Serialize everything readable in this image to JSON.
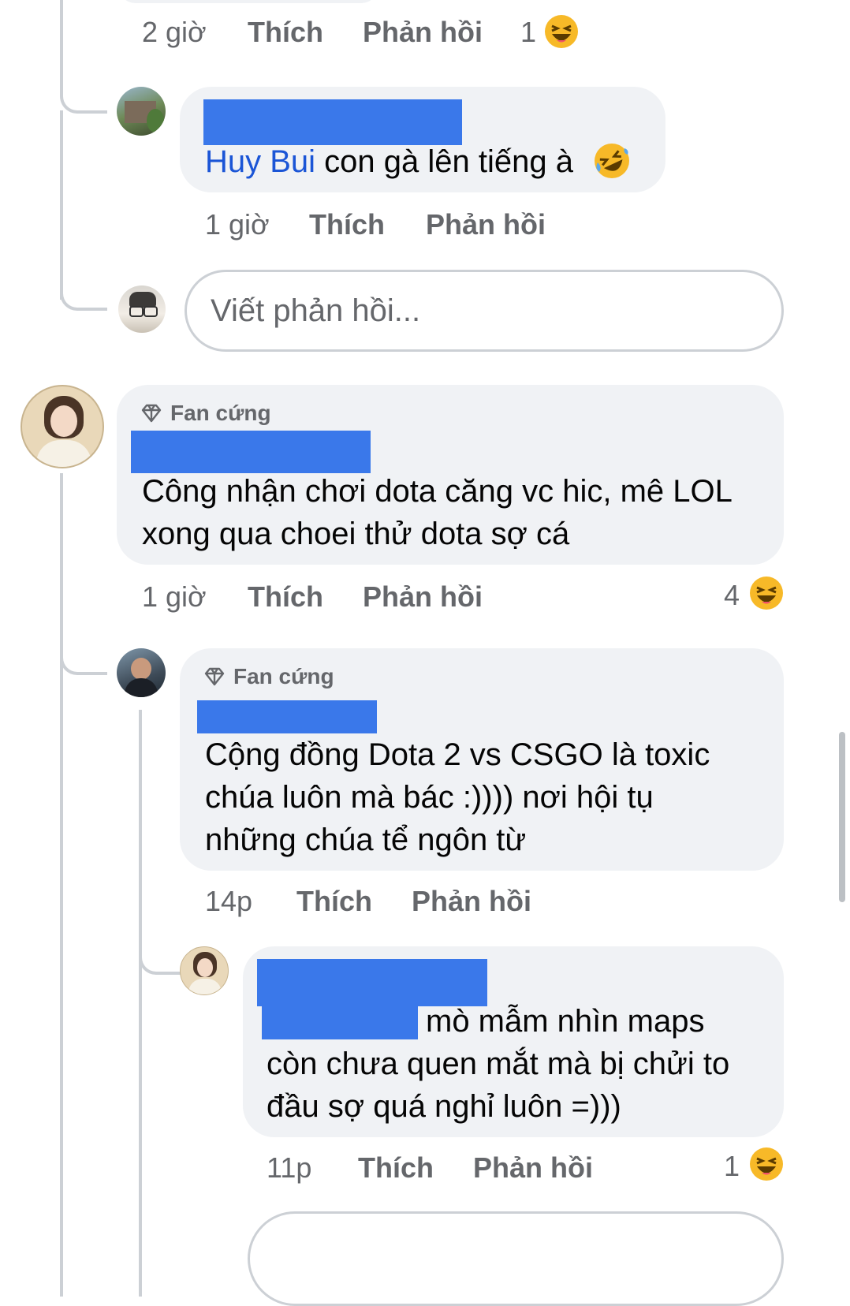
{
  "comments": [
    {
      "id": "c0_tail",
      "time": "2 giờ",
      "like": "Thích",
      "reply": "Phản hồi",
      "reaction_count": "1",
      "reaction_icon": "laughing-emoji-icon"
    },
    {
      "id": "c1",
      "mention": "Huy Bui",
      "text": " con gà lên tiếng à",
      "emoji_icon": "rolling-laughing-emoji-icon",
      "time": "1 giờ",
      "like": "Thích",
      "reply": "Phản hồi"
    },
    {
      "id": "c2",
      "badge": "Fan cứng",
      "text_lines": [
        "Công nhận chơi dota căng vc hic, mê LOL",
        "xong qua choei thử dota sợ cá"
      ],
      "time": "1 giờ",
      "like": "Thích",
      "reply": "Phản hồi",
      "reaction_count": "4",
      "reaction_icon": "laughing-emoji-icon"
    },
    {
      "id": "c3",
      "badge": "Fan cứng",
      "text_lines": [
        "Cộng đồng Dota 2 vs CSGO là toxic",
        "chúa luôn mà bác :)))) nơi hội tụ",
        "những chúa tể ngôn từ"
      ],
      "time": "14p",
      "like": "Thích",
      "reply": "Phản hồi"
    },
    {
      "id": "c4",
      "text_lines": [
        "mò mẫm nhìn maps",
        "còn chưa quen mắt mà bị chửi to",
        "đầu sợ quá nghỉ luôn =)))"
      ],
      "time": "11p",
      "like": "Thích",
      "reply": "Phản hồi",
      "reaction_count": "1",
      "reaction_icon": "laughing-emoji-icon"
    }
  ],
  "reply_input": {
    "placeholder": "Viết phản hồi..."
  },
  "colors": {
    "bubble": "#f0f2f5",
    "redaction": "#3a78ea",
    "mention": "#1b55d6",
    "meta": "#65676b",
    "thread_line": "#ccd0d5"
  }
}
